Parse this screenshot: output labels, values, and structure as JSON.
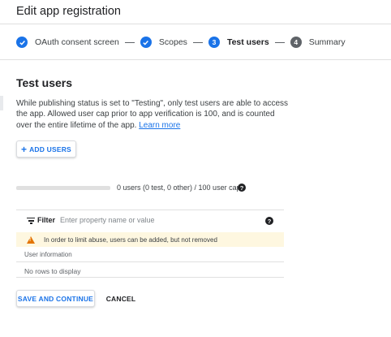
{
  "header": {
    "title": "Edit app registration"
  },
  "stepper": {
    "steps": [
      {
        "label": "OAuth consent screen",
        "state": "done",
        "marker": ""
      },
      {
        "label": "Scopes",
        "state": "done",
        "marker": ""
      },
      {
        "label": "Test users",
        "state": "current",
        "marker": "3"
      },
      {
        "label": "Summary",
        "state": "todo",
        "marker": "4"
      }
    ]
  },
  "section": {
    "title": "Test users",
    "description": "While publishing status is set to \"Testing\", only test users are able to access the app. Allowed user cap prior to app verification is 100, and is counted over the entire lifetime of the app.",
    "learn_more": "Learn more"
  },
  "add_users": {
    "icon": "plus-icon",
    "label": "ADD USERS"
  },
  "user_cap": {
    "used": 0,
    "cap": 100,
    "text": "0 users (0 test, 0 other) / 100 user cap",
    "help_icon": "help-circle-icon"
  },
  "filter": {
    "icon": "filter-icon",
    "label": "Filter",
    "placeholder": "Enter property name or value",
    "value": "",
    "help_icon": "help-circle-icon"
  },
  "warning": {
    "icon": "warning-icon",
    "text": "In order to limit abuse, users can be added, but not removed",
    "color": "#fef7e0"
  },
  "table": {
    "column_header": "User information",
    "empty_text": "No rows to display"
  },
  "actions": {
    "save_label": "SAVE AND CONTINUE",
    "cancel_label": "CANCEL"
  },
  "colors": {
    "accent": "#1a73e8",
    "text": "#202124",
    "muted": "#5f6368",
    "warning_icon": "#e37400"
  }
}
